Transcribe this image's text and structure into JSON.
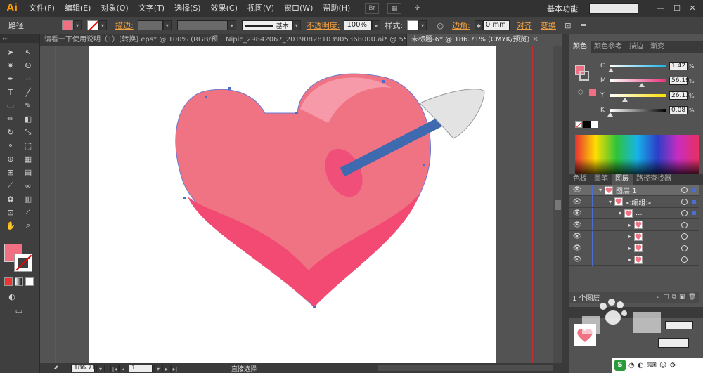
{
  "app": {
    "logo": "Ai",
    "menu": [
      "文件(F)",
      "编辑(E)",
      "对象(O)",
      "文字(T)",
      "选择(S)",
      "效果(C)",
      "视图(V)",
      "窗口(W)",
      "帮助(H)"
    ],
    "workspace": "基本功能",
    "br_icon": "Br"
  },
  "control": {
    "object_type": "路径",
    "fill_color": "#f06f82",
    "stroke_label": "描边:",
    "stroke_style": "基本",
    "opacity_label": "不透明度:",
    "opacity_value": "100%",
    "style_label": "样式:",
    "corner_label": "边角:",
    "corner_value": "0 mm",
    "align_label": "对齐",
    "transform_label": "变换"
  },
  "tabs": [
    {
      "label": "请看一下使用说明（1）[转换].eps* @ 100% (RGB/预...",
      "active": false
    },
    {
      "label": "Nipic_29842067_20190828103905368000.ai* @ 55%...",
      "active": false
    },
    {
      "label": "未标题-6* @ 186.71% (CMYK/预览)",
      "active": true
    }
  ],
  "tools": [
    "selection-arrow",
    "direct-select",
    "magic-wand",
    "lasso",
    "pen",
    "curvature",
    "type",
    "line",
    "rectangle",
    "paintbrush",
    "pencil",
    "eraser",
    "rotate",
    "scale",
    "warp",
    "free-transform",
    "shape-builder",
    "perspective",
    "mesh",
    "gradient",
    "eyedropper",
    "blend",
    "symbol-sprayer",
    "graph",
    "artboard",
    "slice",
    "hand",
    "zoom"
  ],
  "fill_stroke": {
    "fill": "#f06f82"
  },
  "color_panel": {
    "tabs": [
      "颜色",
      "颜色参考",
      "描边",
      "渐变"
    ],
    "values": [
      {
        "letter": "C",
        "value": "1.42",
        "pct": 0.014,
        "from": "#ffffff",
        "to": "#16b4e8"
      },
      {
        "letter": "M",
        "value": "56.19",
        "pct": 0.562,
        "from": "#ffffff",
        "to": "#e8307a"
      },
      {
        "letter": "Y",
        "value": "26.13",
        "pct": 0.261,
        "from": "#ffffff",
        "to": "#ffde00"
      },
      {
        "letter": "K",
        "value": "0.08",
        "pct": 0.001,
        "from": "#ffffff",
        "to": "#000000"
      }
    ],
    "unit": "%"
  },
  "layers_panel": {
    "tabs": [
      "色板",
      "画笔",
      "图层",
      "路径查找器"
    ],
    "rows": [
      {
        "label": "图层 1",
        "level": 0
      },
      {
        "label": "<编组>",
        "level": 1
      },
      {
        "label": "...",
        "level": 2
      },
      {
        "label": "",
        "level": 3
      },
      {
        "label": "",
        "level": 3
      },
      {
        "label": "",
        "level": 3
      },
      {
        "label": "",
        "level": 3
      }
    ],
    "footer": "1 个图层"
  },
  "status": {
    "zoom": "186.71",
    "page": "1",
    "tool": "直接选择"
  }
}
